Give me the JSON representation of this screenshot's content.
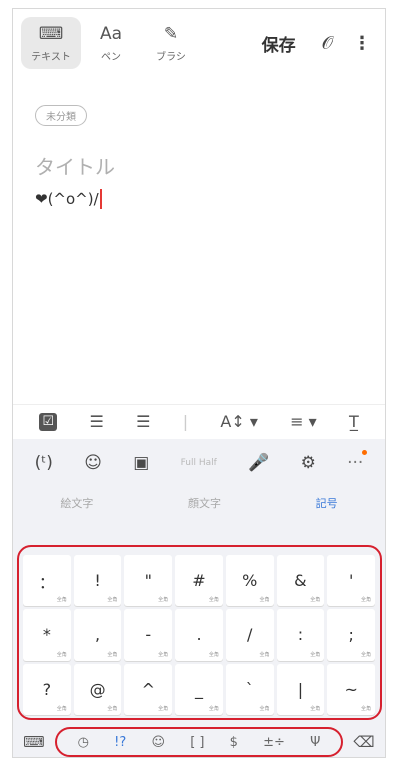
{
  "toolbar": {
    "modes": [
      {
        "label": "テキスト",
        "icon": "⌨"
      },
      {
        "label": "ペン",
        "icon": "Aa"
      },
      {
        "label": "ブラシ",
        "icon": "✎"
      }
    ],
    "save_label": "保存",
    "attach_icon": "𝒪",
    "more_icon": "⋮"
  },
  "note": {
    "category": "未分類",
    "title_placeholder": "タイトル",
    "content": "❤(^o^)/"
  },
  "format_icons": [
    "☑",
    "☰",
    "☰",
    "|",
    "A↕ ▾",
    "≡ ▾",
    "T̲"
  ],
  "keyboard": {
    "top_icons": [
      "(ᵗ)",
      "☺",
      "▣",
      "Full Half",
      "🎤",
      "⚙",
      "···"
    ],
    "tabs": [
      "絵文字",
      "顔文字",
      "記号"
    ],
    "active_tab": "記号",
    "symbol_keys": [
      [
        "：",
        "!",
        "\"",
        "#",
        "%",
        "&",
        "'"
      ],
      [
        "*",
        ",",
        "-",
        ".",
        "/",
        ":",
        ";"
      ],
      [
        "?",
        "@",
        "^",
        "_",
        "`",
        "|",
        "~"
      ]
    ],
    "symbol_sub": "全角",
    "bottom": {
      "keyboard_icon": "⌨",
      "categories": [
        "◷",
        "!?",
        "☺",
        "[ ]",
        "$",
        "±÷",
        "Ψ"
      ],
      "active_category": "!?",
      "delete_icon": "⌫"
    }
  },
  "colors": {
    "highlight": "#d6202e",
    "accent": "#3a79d8"
  }
}
